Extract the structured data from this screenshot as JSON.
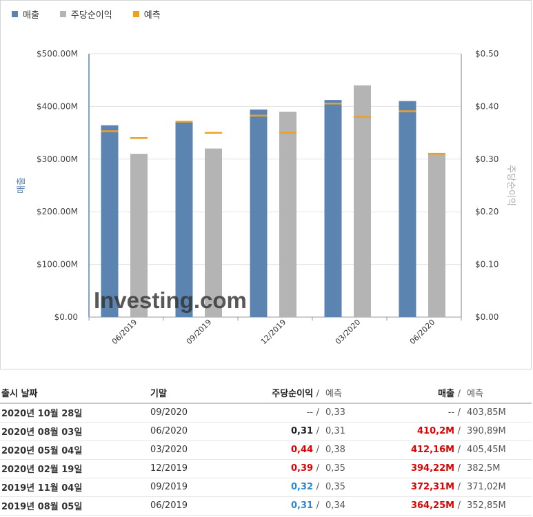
{
  "legend": {
    "revenue": "매출",
    "eps": "주당순이익",
    "forecast": "예측"
  },
  "chart_data": {
    "type": "bar",
    "categories": [
      "06/2019",
      "09/2019",
      "12/2019",
      "03/2020",
      "06/2020"
    ],
    "series": [
      {
        "name": "매출",
        "axis": "left",
        "color": "#5b84b1",
        "values": [
          364.25,
          372.31,
          394.22,
          412.16,
          410.2
        ]
      },
      {
        "name": "주당순이익",
        "axis": "right",
        "color": "#b4b4b4",
        "values": [
          0.31,
          0.32,
          0.39,
          0.44,
          0.31
        ]
      }
    ],
    "forecast": {
      "name": "예측",
      "color": "#f0a020",
      "revenue": [
        352.85,
        371.02,
        382.5,
        405.45,
        390.89
      ],
      "eps": [
        0.34,
        0.35,
        0.35,
        0.38,
        0.31
      ]
    },
    "ylabel_left": "매출",
    "ylabel_right": "주당순이익",
    "ylim_left": [
      0,
      500
    ],
    "ylim_right": [
      0,
      0.5
    ],
    "yticks_left": [
      "$0.00",
      "$100.00M",
      "$200.00M",
      "$300.00M",
      "$400.00M",
      "$500.00M"
    ],
    "yticks_right": [
      "$0.00",
      "$0.10",
      "$0.20",
      "$0.30",
      "$0.40",
      "$0.50"
    ],
    "grid": true,
    "legend_position": "top-left"
  },
  "watermark": "Investing.com",
  "colors": {
    "revenue_bar": "#5b84b1",
    "eps_bar": "#b4b4b4",
    "forecast_line": "#f0a020",
    "beat": "#e00000",
    "miss": "#2a8ad4"
  },
  "table": {
    "headers": {
      "date": "출시 날짜",
      "period": "기말",
      "eps": "주당순이익",
      "eps_forecast": "예측",
      "revenue": "매출",
      "revenue_forecast": "예측",
      "sep": "/"
    },
    "rows": [
      {
        "date": "2020년 10월 28일",
        "period": "09/2020",
        "eps": "--",
        "eps_color": "gray",
        "eps_forecast": "0,33",
        "revenue": "--",
        "revenue_color": "gray",
        "revenue_forecast": "403,85M"
      },
      {
        "date": "2020년 08월 03일",
        "period": "06/2020",
        "eps": "0,31",
        "eps_color": "black",
        "eps_forecast": "0,31",
        "revenue": "410,2M",
        "revenue_color": "red",
        "revenue_forecast": "390,89M"
      },
      {
        "date": "2020년 05월 04일",
        "period": "03/2020",
        "eps": "0,44",
        "eps_color": "red",
        "eps_forecast": "0,38",
        "revenue": "412,16M",
        "revenue_color": "red",
        "revenue_forecast": "405,45M"
      },
      {
        "date": "2020년 02월 19일",
        "period": "12/2019",
        "eps": "0,39",
        "eps_color": "red",
        "eps_forecast": "0,35",
        "revenue": "394,22M",
        "revenue_color": "red",
        "revenue_forecast": "382,5M"
      },
      {
        "date": "2019년 11월 04일",
        "period": "09/2019",
        "eps": "0,32",
        "eps_color": "blue",
        "eps_forecast": "0,35",
        "revenue": "372,31M",
        "revenue_color": "red",
        "revenue_forecast": "371,02M"
      },
      {
        "date": "2019년 08월 05일",
        "period": "06/2019",
        "eps": "0,31",
        "eps_color": "blue",
        "eps_forecast": "0,34",
        "revenue": "364,25M",
        "revenue_color": "red",
        "revenue_forecast": "352,85M"
      }
    ]
  }
}
